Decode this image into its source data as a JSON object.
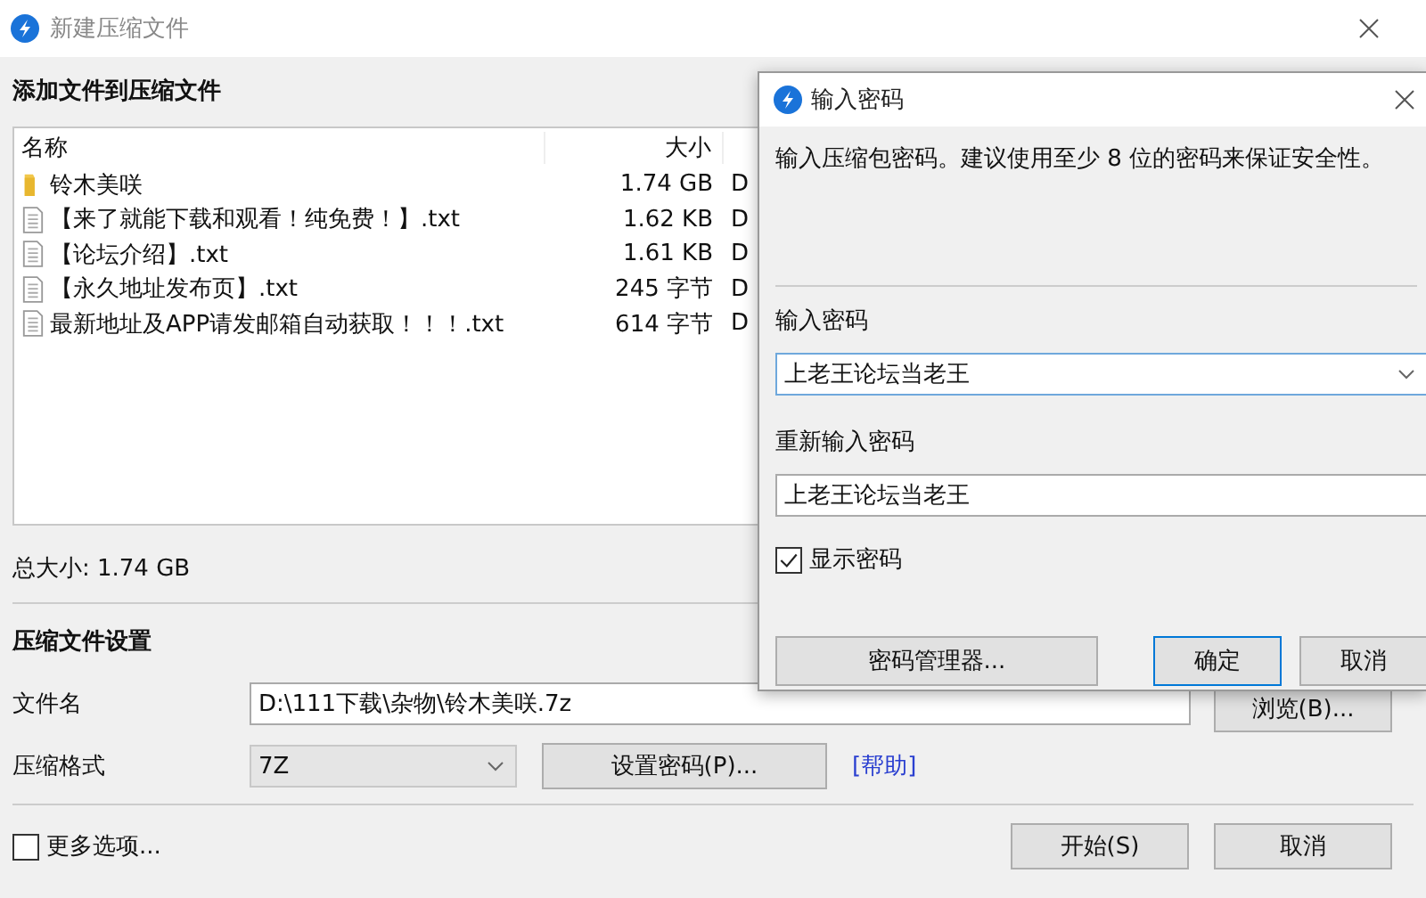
{
  "window": {
    "title": "新建压缩文件"
  },
  "main": {
    "heading": "添加文件到压缩文件",
    "file_list": {
      "columns": [
        "名称",
        "大小"
      ],
      "rows": [
        {
          "kind": "folder",
          "name": "铃木美咲",
          "size": "1.74 GB",
          "column_3": "D"
        },
        {
          "kind": "file",
          "name": "【来了就能下载和观看！纯免费！】.txt",
          "size": "1.62 KB",
          "column_3": "D"
        },
        {
          "kind": "file",
          "name": "【论坛介绍】.txt",
          "size": "1.61 KB",
          "column_3": "D"
        },
        {
          "kind": "file",
          "name": "【永久地址发布页】.txt",
          "size": "245 字节",
          "column_3": "D"
        },
        {
          "kind": "file",
          "name": "最新地址及APP请发邮箱自动获取！！！.txt",
          "size": "614 字节",
          "column_3": "D"
        }
      ]
    },
    "total_size": "总大小: 1.74 GB",
    "settings_heading": "压缩文件设置",
    "filename_label": "文件名",
    "filename_value": "D:\\111下载\\杂物\\铃木美咲.7z",
    "browse_button": "浏览(B)...",
    "format_label": "压缩格式",
    "format_value": "7Z",
    "set_password_button": "设置密码(P)...",
    "help_link": "[帮助]",
    "more_options": {
      "label": "更多选项...",
      "checked": false
    },
    "start_button": "开始(S)",
    "cancel_button": "取消"
  },
  "dialog": {
    "title": "输入密码",
    "description": "输入压缩包密码。建议使用至少 8 位的密码来保证安全性。",
    "password_label": "输入密码",
    "password_value": "上老王论坛当老王",
    "confirm_label": "重新输入密码",
    "confirm_value": "上老王论坛当老王",
    "show_password": {
      "label": "显示密码",
      "checked": true
    },
    "manager_button": "密码管理器...",
    "ok_button": "确定",
    "cancel_button": "取消"
  }
}
